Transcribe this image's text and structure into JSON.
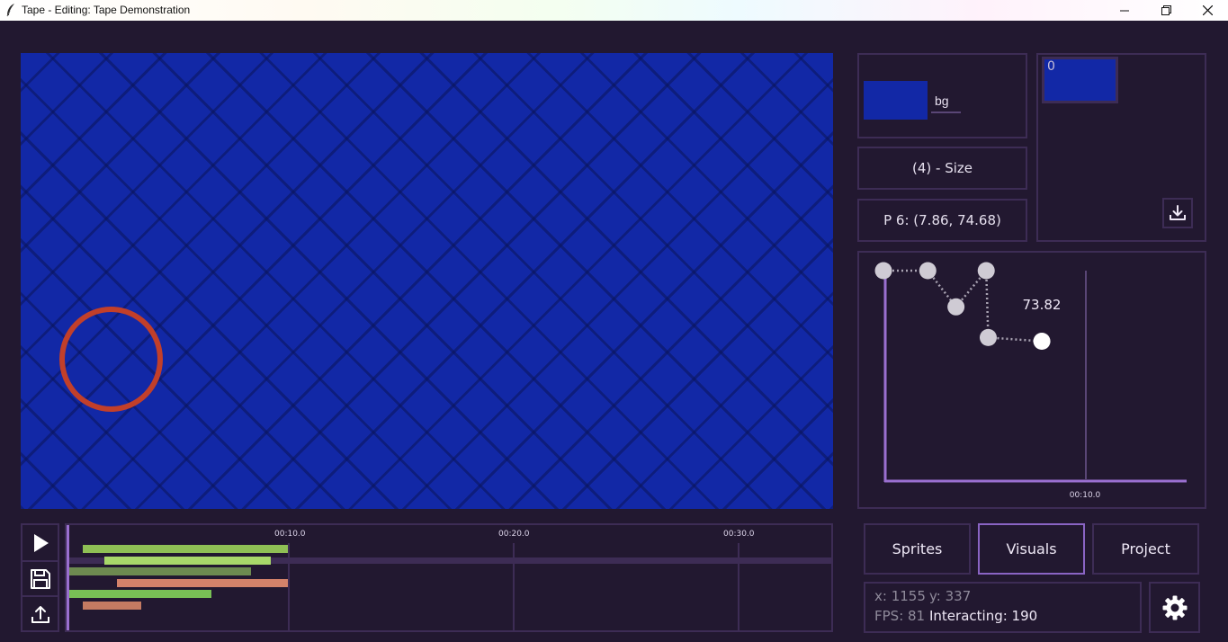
{
  "window": {
    "title": "Tape - Editing: Tape Demonstration",
    "icon": "feather-icon",
    "controls": [
      "minimize-icon",
      "restore-icon",
      "close-icon"
    ]
  },
  "stage": {
    "background_color": "#1228a6",
    "sprite_color": "#c23f2a"
  },
  "sprite_card": {
    "name": "bg",
    "swatch_color": "#1228a6"
  },
  "property": {
    "size_label": "(4) - Size",
    "point_label": "P 6: (7.86, 74.68)"
  },
  "frames": {
    "items": [
      {
        "index": "0",
        "color": "#1228a6"
      }
    ],
    "download_icon": "download-icon"
  },
  "graph": {
    "value_label": "73.82",
    "time_label": "00:10.0",
    "points": [
      {
        "t": 0.0,
        "v": 100
      },
      {
        "t": 2.2,
        "v": 100
      },
      {
        "t": 3.6,
        "v": 87
      },
      {
        "t": 5.1,
        "v": 100
      },
      {
        "t": 5.2,
        "v": 76
      },
      {
        "t": 7.86,
        "v": 74.68
      }
    ]
  },
  "timeline": {
    "ticks": [
      "00:10.0",
      "00:20.0",
      "00:30.0"
    ],
    "tracks": [
      {
        "start": 0.6,
        "end": 10.0,
        "color": "#8fbf55"
      },
      {
        "start": 1.6,
        "end": 9.2,
        "color": "#a8d86a"
      },
      {
        "start": 0.0,
        "end": 8.3,
        "color": "#6d8a50"
      },
      {
        "start": 2.2,
        "end": 10.0,
        "color": "#d3826a"
      },
      {
        "start": 0.0,
        "end": 6.5,
        "color": "#78bf55"
      },
      {
        "start": 0.6,
        "end": 3.3,
        "color": "#c57a62"
      }
    ],
    "buttons": [
      "play-icon",
      "save-icon",
      "upload-icon"
    ]
  },
  "tabs": [
    "Sprites",
    "Visuals",
    "Project"
  ],
  "active_tab": "Visuals",
  "status": {
    "x": "x: 1155",
    "y": "y: 337",
    "fps": "FPS: 81",
    "interacting": "Interacting: 190"
  },
  "colors": {
    "background": "#221830",
    "border": "#3d2c55",
    "accent": "#8a64c4"
  }
}
